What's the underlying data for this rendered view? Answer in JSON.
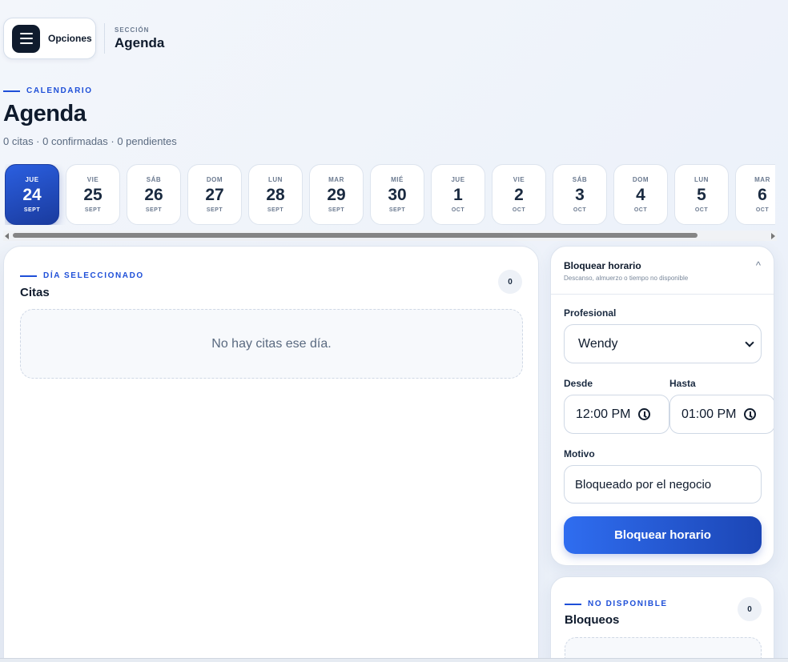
{
  "topbar": {
    "menu_label": "Opciones",
    "section_kicker": "SECCIÓN",
    "section_title": "Agenda"
  },
  "header": {
    "kicker": "CALENDARIO",
    "title": "Agenda",
    "subtitle": "0 citas · 0 confirmadas · 0 pendientes"
  },
  "days": [
    {
      "dow": "JUE",
      "num": "24",
      "month": "SEPT",
      "active": true
    },
    {
      "dow": "VIE",
      "num": "25",
      "month": "SEPT"
    },
    {
      "dow": "SÁB",
      "num": "26",
      "month": "SEPT"
    },
    {
      "dow": "DOM",
      "num": "27",
      "month": "SEPT"
    },
    {
      "dow": "LUN",
      "num": "28",
      "month": "SEPT"
    },
    {
      "dow": "MAR",
      "num": "29",
      "month": "SEPT"
    },
    {
      "dow": "MIÉ",
      "num": "30",
      "month": "SEPT"
    },
    {
      "dow": "JUE",
      "num": "1",
      "month": "OCT"
    },
    {
      "dow": "VIE",
      "num": "2",
      "month": "OCT"
    },
    {
      "dow": "SÁB",
      "num": "3",
      "month": "OCT"
    },
    {
      "dow": "DOM",
      "num": "4",
      "month": "OCT"
    },
    {
      "dow": "LUN",
      "num": "5",
      "month": "OCT"
    },
    {
      "dow": "MAR",
      "num": "6",
      "month": "OCT"
    }
  ],
  "citas": {
    "kicker": "DÍA SELECCIONADO",
    "title": "Citas",
    "count": "0",
    "empty": "No hay citas ese día."
  },
  "block_form": {
    "title": "Bloquear horario",
    "hint": "Descanso, almuerzo o tiempo no disponible",
    "caret": "^",
    "profesional_label": "Profesional",
    "profesional_value": "Wendy",
    "desde_label": "Desde",
    "desde_value": "12:00 PM",
    "hasta_label": "Hasta",
    "hasta_value": "01:00 PM",
    "motivo_label": "Motivo",
    "motivo_value": "Bloqueado por el negocio",
    "submit_label": "Bloquear horario"
  },
  "bloqueos": {
    "kicker": "NO DISPONIBLE",
    "title": "Bloqueos",
    "count": "0"
  },
  "colors": {
    "accent": "#1e4fd8",
    "active_day": "#1a3b9e",
    "text_dark": "#0f1b2d"
  }
}
